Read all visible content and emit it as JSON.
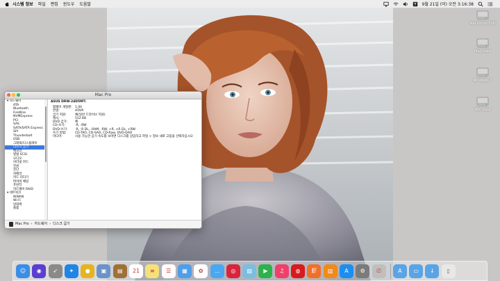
{
  "menubar": {
    "app_name": "시스템 정보",
    "menus": [
      "파일",
      "편집",
      "윈도우",
      "도움말"
    ],
    "clock": "9월 21일 (이) 오전 3:16:38"
  },
  "desktop": {
    "drives": [
      {
        "label": "Macintosh SSD"
      },
      {
        "label": "Mac Data"
      },
      {
        "label": "Windows 7"
      },
      {
        "label": "Win Data"
      }
    ]
  },
  "window": {
    "title": "Mac Pro",
    "sidebar": {
      "items": [
        {
          "label": "▾ 하드웨어",
          "type": "group"
        },
        {
          "label": "ATA"
        },
        {
          "label": "Bluetooth"
        },
        {
          "label": "FireWire"
        },
        {
          "label": "NVMExpress"
        },
        {
          "label": "PCI"
        },
        {
          "label": "SAS"
        },
        {
          "label": "SATA/SATA Express"
        },
        {
          "label": "SPI"
        },
        {
          "label": "Thunderbolt"
        },
        {
          "label": "USB"
        },
        {
          "label": "그래픽/디스플레이"
        },
        {
          "label": "디스크 굽기",
          "selected": true
        },
        {
          "label": "메모리"
        },
        {
          "label": "병렬 SCSI"
        },
        {
          "label": "오디오"
        },
        {
          "label": "이더넷 카드"
        },
        {
          "label": "전원"
        },
        {
          "label": "진단"
        },
        {
          "label": "카메라"
        },
        {
          "label": "카드 리더기"
        },
        {
          "label": "파이버 채널"
        },
        {
          "label": "프린터"
        },
        {
          "label": "하드웨어 RAID"
        },
        {
          "label": "▾ 네트워크",
          "type": "group"
        },
        {
          "label": "WWAN"
        },
        {
          "label": "Wi-Fi"
        },
        {
          "label": "방화벽"
        },
        {
          "label": "볼륨"
        }
      ]
    },
    "content": {
      "heading": "ASUS DRW-24D5MT:",
      "rows": [
        {
          "k": "펌웨어 개정판:",
          "v": "1.00"
        },
        {
          "k": "연결:",
          "v": "ATAPI"
        },
        {
          "k": "굽기 지원:",
          "v": "예(일반 드라이브 지원)"
        },
        {
          "k": "캐시:",
          "v": "512 KB"
        },
        {
          "k": "DVD 굽기:",
          "v": "예"
        },
        {
          "k": "CD-쓰기:",
          "v": "-R, -RW"
        },
        {
          "k": "DVD-쓰기:",
          "v": "-R, -R DL, -RAM, -RW, +R, +R DL, +RW"
        },
        {
          "k": "쓰기 방법:",
          "v": "CD-TAO, CD-SAO, CD-Raw, DVD-DAO"
        },
        {
          "k": "미디어:",
          "v": "사용 가능한 굽기 속도를 보려면 디스크를 삽입하고 파일 > 정보 새로 고침을 선택하십시오"
        }
      ]
    },
    "pathbar": [
      "Mac Pro",
      "›",
      "하드웨어",
      "›",
      "디스크 굽기"
    ]
  },
  "dock": {
    "apps": [
      {
        "name": "finder-icon",
        "color": "#3a8ee6",
        "glyph": "☺"
      },
      {
        "name": "siri-icon",
        "color": "#5a3fd0",
        "glyph": "◉"
      },
      {
        "name": "launchpad-icon",
        "color": "#8a8a8a",
        "glyph": "➶"
      },
      {
        "name": "safari-icon",
        "color": "#1f86e5",
        "glyph": "✦"
      },
      {
        "name": "chrome-icon",
        "color": "#e6b422",
        "glyph": "●"
      },
      {
        "name": "preview-icon",
        "color": "#6c93c8",
        "glyph": "▣"
      },
      {
        "name": "notes-book-icon",
        "color": "#a0703a",
        "glyph": "▤"
      },
      {
        "name": "calendar-icon",
        "color": "#ffffff",
        "glyph": "21"
      },
      {
        "name": "notes-icon",
        "color": "#f6e07a",
        "glyph": "≡"
      },
      {
        "name": "reminders-icon",
        "color": "#ffffff",
        "glyph": "☰"
      },
      {
        "name": "keynote-icon",
        "color": "#4f9ee8",
        "glyph": "▦"
      },
      {
        "name": "photos-icon",
        "color": "#ffffff",
        "glyph": "✿"
      },
      {
        "name": "messages-icon",
        "color": "#4aa8f0",
        "glyph": "…"
      },
      {
        "name": "photobooth-icon",
        "color": "#d8243c",
        "glyph": "◎"
      },
      {
        "name": "photos-import-icon",
        "color": "#7dbde0",
        "glyph": "▨"
      },
      {
        "name": "facetime-icon",
        "color": "#2bb24c",
        "glyph": "▶"
      },
      {
        "name": "itunes-icon",
        "color": "#f0406a",
        "glyph": "♫"
      },
      {
        "name": "netease-music-icon",
        "color": "#d8191e",
        "glyph": "◍"
      },
      {
        "name": "xiami-icon",
        "color": "#f0702a",
        "glyph": "虾"
      },
      {
        "name": "ibooks-icon",
        "color": "#f08a1d",
        "glyph": "▥"
      },
      {
        "name": "appstore-icon",
        "color": "#1c8ef0",
        "glyph": "A"
      },
      {
        "name": "system-preferences-icon",
        "color": "#7b7b7b",
        "glyph": "⚙"
      },
      {
        "name": "system-information-icon",
        "color": "#bfbfbf",
        "glyph": "⎚"
      },
      {
        "name": "applications-folder-icon",
        "color": "#5aa4e6",
        "glyph": "A"
      },
      {
        "name": "documents-folder-icon",
        "color": "#5aa4e6",
        "glyph": "▭"
      },
      {
        "name": "downloads-folder-icon",
        "color": "#5aa4e6",
        "glyph": "↓"
      },
      {
        "name": "trash-icon",
        "color": "#e8e8e8",
        "glyph": "▯"
      }
    ]
  }
}
